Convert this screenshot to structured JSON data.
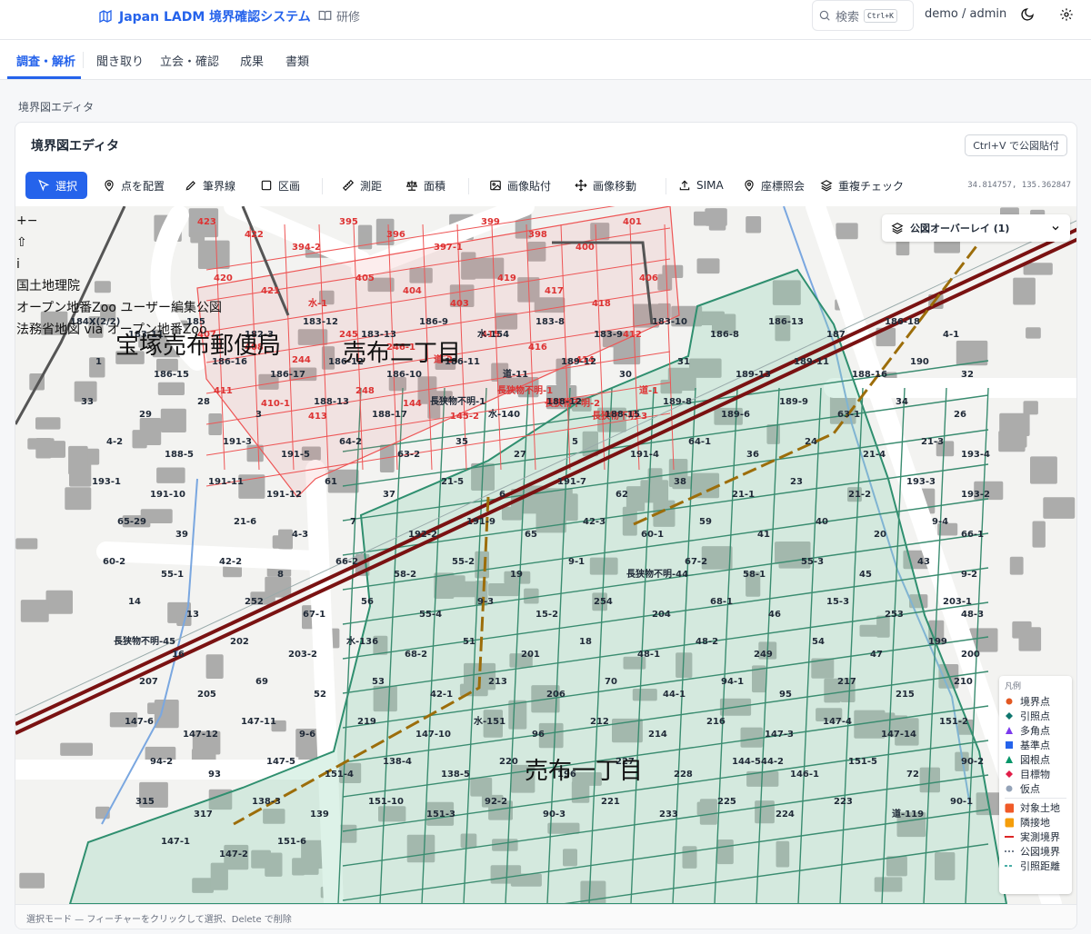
{
  "header": {
    "app_title": "Japan LADM 境界確認システム",
    "training_label": "研修",
    "search_label": "検索",
    "search_shortcut": "Ctrl+K",
    "user": "demo / admin"
  },
  "tabs": [
    {
      "label": "調査・解析",
      "active": true
    },
    {
      "label": "聞き取り"
    },
    {
      "label": "立会・確認"
    },
    {
      "label": "成果"
    },
    {
      "label": "書類"
    }
  ],
  "breadcrumb": "境界図エディタ",
  "editor": {
    "title": "境界図エディタ",
    "paste_hint": "Ctrl+V で公図貼付",
    "coordinates": "34.814757, 135.362847",
    "tools": [
      {
        "label": "選択",
        "icon": "pointer-icon",
        "active": true
      },
      {
        "label": "点を配置",
        "icon": "map-pin-icon"
      },
      {
        "label": "筆界線",
        "icon": "pencil-icon"
      },
      {
        "label": "区画",
        "icon": "square-icon"
      },
      {
        "label": "測距",
        "icon": "ruler-icon"
      },
      {
        "label": "面積",
        "icon": "scale-icon"
      },
      {
        "label": "画像貼付",
        "icon": "image-icon"
      },
      {
        "label": "画像移動",
        "icon": "move-icon"
      },
      {
        "label": "SIMA",
        "icon": "upload-icon"
      },
      {
        "label": "座標照会",
        "icon": "map-pin-icon"
      },
      {
        "label": "重複チェック",
        "icon": "layers-icon"
      }
    ]
  },
  "map": {
    "zoom_in": "+",
    "zoom_out": "−",
    "compass": "⇧",
    "info": "i",
    "attributions": [
      "国土地理院",
      "オープン地番Zoo ユーザー編集公図",
      "法務省地図 via オープン地番Zoo"
    ],
    "overlay_label": "公図オーバーレイ (1)",
    "place_names": [
      "宝塚売布郵便局",
      "売布二丁目",
      "売布一丁目"
    ],
    "parcel_labels_red": [
      "423",
      "422",
      "394-2",
      "395",
      "396",
      "397-1",
      "399",
      "398",
      "400",
      "401",
      "420",
      "421",
      "水-1",
      "405",
      "404",
      "403",
      "419",
      "417",
      "418",
      "406",
      "407",
      "408",
      "244",
      "245",
      "246-1",
      "道-2",
      "415",
      "416",
      "414",
      "412",
      "411",
      "410-1",
      "413",
      "248",
      "144",
      "145-2",
      "長狭物不明-1",
      "長狭物不明-2",
      "長狭物不明-3",
      "道-1"
    ],
    "parcel_labels_green": [
      "184X(2/2)",
      "183-11",
      "185",
      "182-3",
      "183-12",
      "183-13",
      "186-9",
      "水-154",
      "183-8",
      "183-9",
      "183-10",
      "186-8",
      "186-13",
      "187",
      "186-18",
      "4-1",
      "1",
      "186-15",
      "186-16",
      "186-17",
      "186-12",
      "186-10",
      "186-11",
      "道-11",
      "189-12",
      "30",
      "31",
      "189-13",
      "189-11",
      "188-16",
      "190",
      "32",
      "33",
      "29",
      "28",
      "3",
      "188-13",
      "188-17",
      "長狭物不明-1",
      "水-140",
      "188-12",
      "188-15",
      "189-8",
      "189-6",
      "189-9",
      "63-1",
      "34",
      "26",
      "4-2",
      "188-5",
      "191-3",
      "191-5",
      "64-2",
      "63-2",
      "35",
      "27",
      "5",
      "191-4",
      "64-1",
      "36",
      "24",
      "21-4",
      "21-3",
      "193-4",
      "193-1",
      "191-10",
      "191-11",
      "191-12",
      "61",
      "37",
      "21-5",
      "6",
      "191-7",
      "62",
      "38",
      "21-1",
      "23",
      "21-2",
      "193-3",
      "193-2",
      "65-29",
      "39",
      "21-6",
      "4-3",
      "7",
      "192-2",
      "191-9",
      "65",
      "42-3",
      "60-1",
      "59",
      "41",
      "40",
      "20",
      "9-4",
      "66-1",
      "60-2",
      "55-1",
      "42-2",
      "8",
      "66-2",
      "58-2",
      "55-2",
      "19",
      "9-1",
      "長狭物不明-44",
      "67-2",
      "58-1",
      "55-3",
      "45",
      "43",
      "9-2",
      "14",
      "13",
      "252",
      "67-1",
      "56",
      "55-4",
      "9-3",
      "15-2",
      "254",
      "204",
      "68-1",
      "46",
      "15-3",
      "253",
      "203-1",
      "48-3",
      "長狭物不明-45",
      "16",
      "202",
      "203-2",
      "水-136",
      "68-2",
      "51",
      "201",
      "18",
      "48-1",
      "48-2",
      "249",
      "54",
      "47",
      "199",
      "200",
      "207",
      "205",
      "69",
      "52",
      "53",
      "42-1",
      "213",
      "206",
      "70",
      "44-1",
      "94-1",
      "95",
      "217",
      "215",
      "210",
      "147-7",
      "147-6",
      "147-12",
      "147-11",
      "9-6",
      "219",
      "147-10",
      "水-151",
      "96",
      "212",
      "214",
      "216",
      "147-3",
      "147-4",
      "147-14",
      "151-2",
      "71",
      "94-2",
      "93",
      "147-5",
      "151-4",
      "138-4",
      "138-5",
      "220",
      "196",
      "227",
      "228",
      "144-544-2",
      "146-1",
      "151-5",
      "72",
      "90-2",
      "97",
      "315",
      "317",
      "138-3",
      "139",
      "151-10",
      "151-3",
      "92-2",
      "90-3",
      "221",
      "233",
      "225",
      "224",
      "223",
      "道-119",
      "90-1",
      "144-3",
      "147-1",
      "147-2",
      "151-6"
    ]
  },
  "legend": {
    "title": "凡例",
    "items": [
      {
        "label": "境界点",
        "color": "#e25822"
      },
      {
        "label": "引照点",
        "color": "#0f766e"
      },
      {
        "label": "多角点",
        "color": "#7c3aed"
      },
      {
        "label": "基準点",
        "color": "#2563eb"
      },
      {
        "label": "図根点",
        "color": "#059669"
      },
      {
        "label": "目標物",
        "color": "#e11d48"
      },
      {
        "label": "仮点",
        "color": "#94a3b8"
      },
      {
        "label": "対象土地",
        "color": "#f05a28"
      },
      {
        "label": "隣接地",
        "color": "#f59e0b"
      },
      {
        "label": "実測境界",
        "color": "#dc2626"
      },
      {
        "label": "公図境界",
        "color": "#475569"
      },
      {
        "label": "引照距離",
        "color": "#0d9488"
      }
    ]
  },
  "status": "選択モード — フィーチャーをクリックして選択、Delete で削除"
}
